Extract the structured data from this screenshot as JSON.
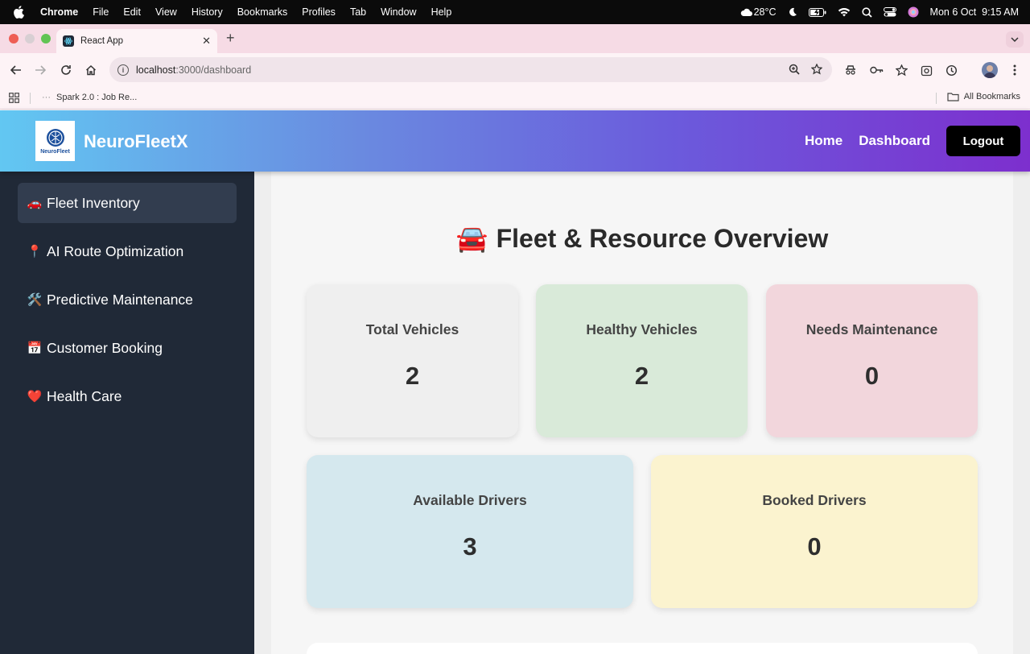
{
  "menubar": {
    "app": "Chrome",
    "items": [
      "File",
      "Edit",
      "View",
      "History",
      "Bookmarks",
      "Profiles",
      "Tab",
      "Window",
      "Help"
    ],
    "weather": "28°C",
    "datetime": "Mon 6 Oct  9:15 AM"
  },
  "browser": {
    "tab_title": "React App",
    "url_host": "localhost",
    "url_path": ":3000/dashboard",
    "bookmark": "Spark 2.0 : Job Re...",
    "all_bookmarks": "All Bookmarks"
  },
  "header": {
    "logo_text": "NeuroFleet",
    "brand": "NeuroFleetX",
    "nav": [
      "Home",
      "Dashboard"
    ],
    "logout": "Logout"
  },
  "sidebar": {
    "items": [
      {
        "emoji": "🚗",
        "label": "Fleet Inventory"
      },
      {
        "emoji": "📍",
        "label": "AI Route Optimization"
      },
      {
        "emoji": "🛠️",
        "label": "Predictive Maintenance"
      },
      {
        "emoji": "📅",
        "label": "Customer Booking"
      },
      {
        "emoji": "❤️",
        "label": "Health Care"
      }
    ]
  },
  "main": {
    "title_emoji": "🚘",
    "title": "Fleet & Resource Overview",
    "cards": [
      {
        "label": "Total Vehicles",
        "value": "2",
        "color": "#efefef"
      },
      {
        "label": "Healthy Vehicles",
        "value": "2",
        "color": "#d9ead9"
      },
      {
        "label": "Needs Maintenance",
        "value": "0",
        "color": "#f2d6dc"
      },
      {
        "label": "Available Drivers",
        "value": "3",
        "color": "#d5e8ee"
      },
      {
        "label": "Booked Drivers",
        "value": "0",
        "color": "#fbf3cf"
      }
    ]
  },
  "colors": {
    "sidebar_bg": "#202937",
    "active_item": "#323d4f",
    "header_gradient_start": "#62c7f2",
    "header_gradient_end": "#7d2fce"
  }
}
